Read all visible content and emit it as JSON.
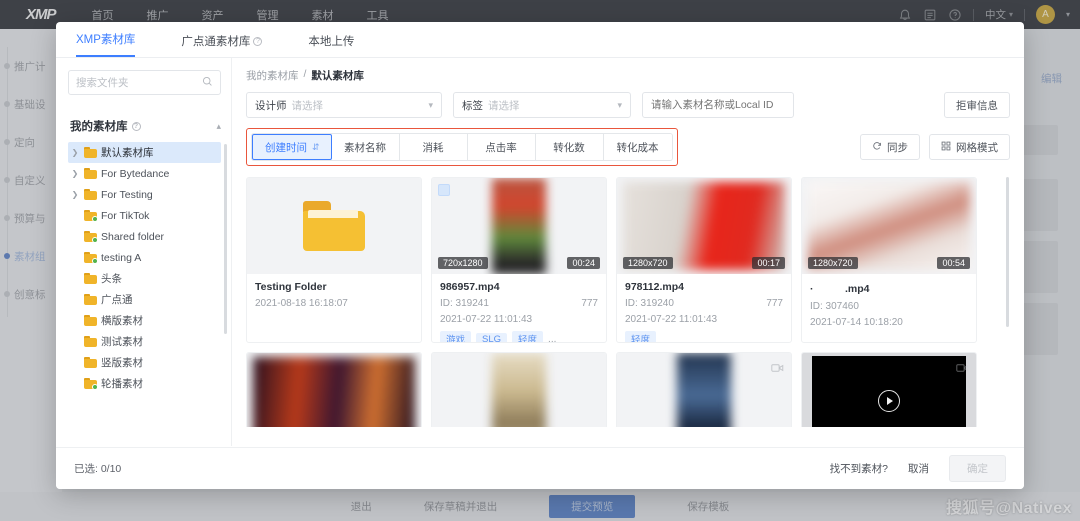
{
  "topnav": {
    "logo": "XMP",
    "items": [
      {
        "label": "首页"
      },
      {
        "label": "推广"
      },
      {
        "label": "资产"
      },
      {
        "label": "管理"
      },
      {
        "label": "素材"
      },
      {
        "label": "工具"
      }
    ],
    "bell_icon": "bell-icon",
    "list_icon": "list-icon",
    "help_icon": "help-icon",
    "language": "中文",
    "avatar_initial": "A"
  },
  "background": {
    "steps": [
      {
        "label": "推广计"
      },
      {
        "label": "基础设"
      },
      {
        "label": "定向"
      },
      {
        "label": "自定义"
      },
      {
        "label": "预算与"
      },
      {
        "label": "素材组"
      },
      {
        "label": "创意标"
      }
    ],
    "active_step_index": 5,
    "edit_link": "编辑",
    "bottom_actions": [
      {
        "label": "退出"
      },
      {
        "label": "保存草稿并退出"
      },
      {
        "label": "提交预览"
      },
      {
        "label": "保存模板"
      }
    ],
    "watermark": "搜狐号@Nativex"
  },
  "modal": {
    "tabs": [
      {
        "label": "XMP素材库",
        "active": true,
        "has_help": false
      },
      {
        "label": "广点通素材库",
        "active": false,
        "has_help": true
      },
      {
        "label": "本地上传",
        "active": false,
        "has_help": false
      }
    ],
    "left": {
      "search_placeholder": "搜索文件夹",
      "search_value": "",
      "search_icon": "search-icon",
      "library_title": "我的素材库",
      "library_help_icon": "help-icon",
      "collapse_icon": "chevron-up-icon",
      "folders": [
        {
          "label": "默认素材库",
          "expandable": true,
          "selected": true,
          "shared": false
        },
        {
          "label": "For Bytedance",
          "expandable": true,
          "selected": false,
          "shared": false
        },
        {
          "label": "For Testing",
          "expandable": true,
          "selected": false,
          "shared": false
        },
        {
          "label": "For TikTok",
          "expandable": false,
          "selected": false,
          "shared": true
        },
        {
          "label": "Shared folder",
          "expandable": false,
          "selected": false,
          "shared": true
        },
        {
          "label": "testing A",
          "expandable": false,
          "selected": false,
          "shared": true
        },
        {
          "label": "头条",
          "expandable": false,
          "selected": false,
          "shared": false
        },
        {
          "label": "广点通",
          "expandable": false,
          "selected": false,
          "shared": false
        },
        {
          "label": "横版素材",
          "expandable": false,
          "selected": false,
          "shared": false
        },
        {
          "label": "测试素材",
          "expandable": false,
          "selected": false,
          "shared": false
        },
        {
          "label": "竖版素材",
          "expandable": false,
          "selected": false,
          "shared": false
        },
        {
          "label": "轮播素材",
          "expandable": false,
          "selected": false,
          "shared": true
        }
      ]
    },
    "right": {
      "breadcrumb": {
        "root": "我的素材库",
        "separator": "/",
        "current": "默认素材库"
      },
      "filters": {
        "designer_label": "设计师",
        "designer_placeholder": "请选择",
        "tag_label": "标签",
        "tag_placeholder": "请选择",
        "name_placeholder": "请输入素材名称或Local ID",
        "name_value": "",
        "reject_button": "拒审信息"
      },
      "sort_tabs": [
        {
          "label": "创建时间",
          "active": true,
          "sort_icon": "sort-desc-icon"
        },
        {
          "label": "素材名称",
          "active": false
        },
        {
          "label": "消耗",
          "active": false
        },
        {
          "label": "点击率",
          "active": false
        },
        {
          "label": "转化数",
          "active": false
        },
        {
          "label": "转化成本",
          "active": false
        }
      ],
      "sync_button": {
        "label": "同步",
        "icon": "refresh-icon"
      },
      "view_button": {
        "label": "网格模式",
        "icon": "grid-icon"
      },
      "cards": [
        {
          "type": "folder",
          "name": "Testing Folder",
          "date": "2021-08-18 16:18:07",
          "icon": "folder-icon"
        },
        {
          "type": "video",
          "orientation": "portrait",
          "resolution": "720x1280",
          "duration": "00:24",
          "name": "986957.mp4",
          "id": "ID: 319241",
          "count": "777",
          "date": "2021-07-22 11:01:43",
          "tags": [
            "游戏",
            "SLG",
            "轻度"
          ],
          "tag_more": "...",
          "checkbox": true,
          "thumb_colors": [
            "#7e5a4e",
            "#c0332a",
            "#4e7a3b",
            "#d8cbb8"
          ]
        },
        {
          "type": "video",
          "orientation": "landscape",
          "resolution": "1280x720",
          "duration": "00:17",
          "name": "978112.mp4",
          "id": "ID: 319240",
          "count": "777",
          "date": "2021-07-22 11:01:43",
          "tags": [
            "轻度"
          ],
          "tag_more": "",
          "checkbox": false,
          "thumb_colors": [
            "#dcd7d2",
            "#e02a20",
            "#b0a9a2",
            "#f0ecea"
          ]
        },
        {
          "type": "video",
          "orientation": "landscape",
          "resolution": "1280x720",
          "duration": "00:54",
          "name": "·　　　.mp4",
          "id": "ID: 307460",
          "count": "",
          "date": "2021-07-14 10:18:20",
          "tags": [],
          "tag_more": "",
          "checkbox": false,
          "thumb_colors": [
            "#f3eeec",
            "#c97f72",
            "#e8ddd8",
            "#f7f3f1"
          ]
        }
      ],
      "cards_row2": [
        {
          "type": "video",
          "orientation": "landscape",
          "thumb_colors": [
            "#2a1020",
            "#c23a1a",
            "#401830",
            "#d07030"
          ],
          "icon": ""
        },
        {
          "type": "video",
          "orientation": "portrait",
          "thumb_colors": [
            "#c9b88e",
            "#e8e0cc",
            "#8c7a58",
            "#d8cdb0"
          ],
          "icon": ""
        },
        {
          "type": "video",
          "orientation": "portrait",
          "thumb_colors": [
            "#22344f",
            "#4a6b96",
            "#16233a",
            "#6d8fc0"
          ],
          "icon": "video-icon"
        },
        {
          "type": "video",
          "orientation": "landscape-dark",
          "thumb_colors": [
            "#000000",
            "#000000",
            "#000000",
            "#000000"
          ],
          "icon": "video-icon",
          "play": "play-icon"
        }
      ]
    },
    "footer": {
      "selected_text": "已选: 0/10",
      "find_link": "找不到素材?",
      "cancel": "取消",
      "confirm": "确定"
    }
  }
}
